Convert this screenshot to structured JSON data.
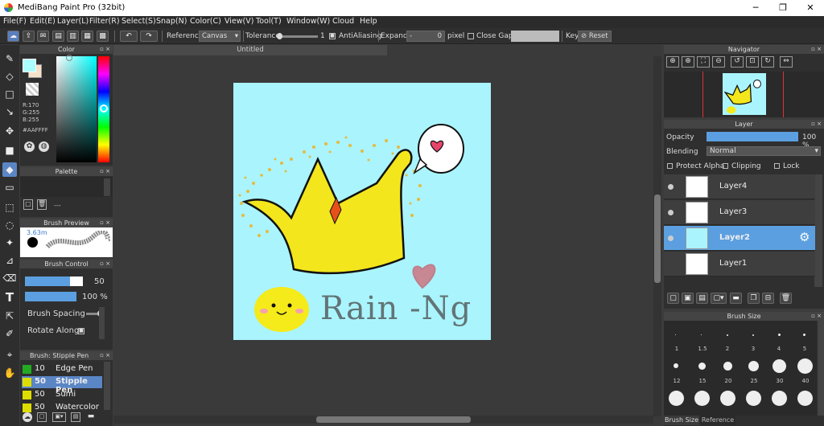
{
  "app": {
    "title": "MediBang Paint Pro (32bit)"
  },
  "menu": [
    "File(F)",
    "Edit(E)",
    "Layer(L)",
    "Filter(R)",
    "Select(S)",
    "Snap(N)",
    "Color(C)",
    "View(V)",
    "Tool(T)",
    "Window(W)",
    "Cloud",
    "Help"
  ],
  "toolbar": {
    "reference_label": "Reference",
    "reference_value": "Canvas",
    "tolerance_label": "Tolerance",
    "tolerance_value": "1",
    "antialiasing_label": "AntiAliasing",
    "expand_label": "Expand",
    "expand_value": "0",
    "expand_unit": "pixel",
    "close_gaps_label": "Close Gaps",
    "key_label": "Key",
    "reset_label": "Reset"
  },
  "color_panel": {
    "title": "Color",
    "r": "R:170",
    "g": "G:255",
    "b": "B:255",
    "hex": "#AAFFFF",
    "current_color": "#aaffff"
  },
  "palette_panel": {
    "title": "Palette",
    "dash": "---"
  },
  "brush_preview": {
    "title": "Brush Preview",
    "size_text": "3.63m"
  },
  "brush_control": {
    "title": "Brush Control",
    "size": "50",
    "opacity": "100 %",
    "spacing_label": "Brush Spacing",
    "rotate_label": "Rotate Along"
  },
  "brush_list": {
    "title": "Brush: Stipple Pen",
    "items": [
      {
        "size": "10",
        "name": "Edge Pen",
        "color": "#22aa22"
      },
      {
        "size": "50",
        "name": "Stipple Pen",
        "color": "#dddd00"
      },
      {
        "size": "50",
        "name": "Sumi",
        "color": "#dddd00"
      },
      {
        "size": "50",
        "name": "Watercolor",
        "color": "#dddd00"
      }
    ]
  },
  "document": {
    "tab": "Untitled"
  },
  "artwork": {
    "signature": "Rain -Ng"
  },
  "navigator": {
    "title": "Navigator"
  },
  "layer_panel": {
    "title": "Layer",
    "opacity_label": "Opacity",
    "opacity_value": "100 %",
    "blending_label": "Blending",
    "blending_value": "Normal",
    "protect_alpha": "Protect Alpha",
    "clipping": "Clipping",
    "lock": "Lock",
    "layers": [
      "Layer4",
      "Layer3",
      "Layer2",
      "Layer1"
    ],
    "selected": "Layer2"
  },
  "brush_size_panel": {
    "title": "Brush Size",
    "sizes_row1": [
      "1",
      "1.5",
      "2",
      "3",
      "4",
      "5"
    ],
    "sizes_row2": [
      "12",
      "15",
      "20",
      "25",
      "30",
      "40"
    ],
    "tabs": [
      "Brush Size",
      "Reference"
    ]
  }
}
